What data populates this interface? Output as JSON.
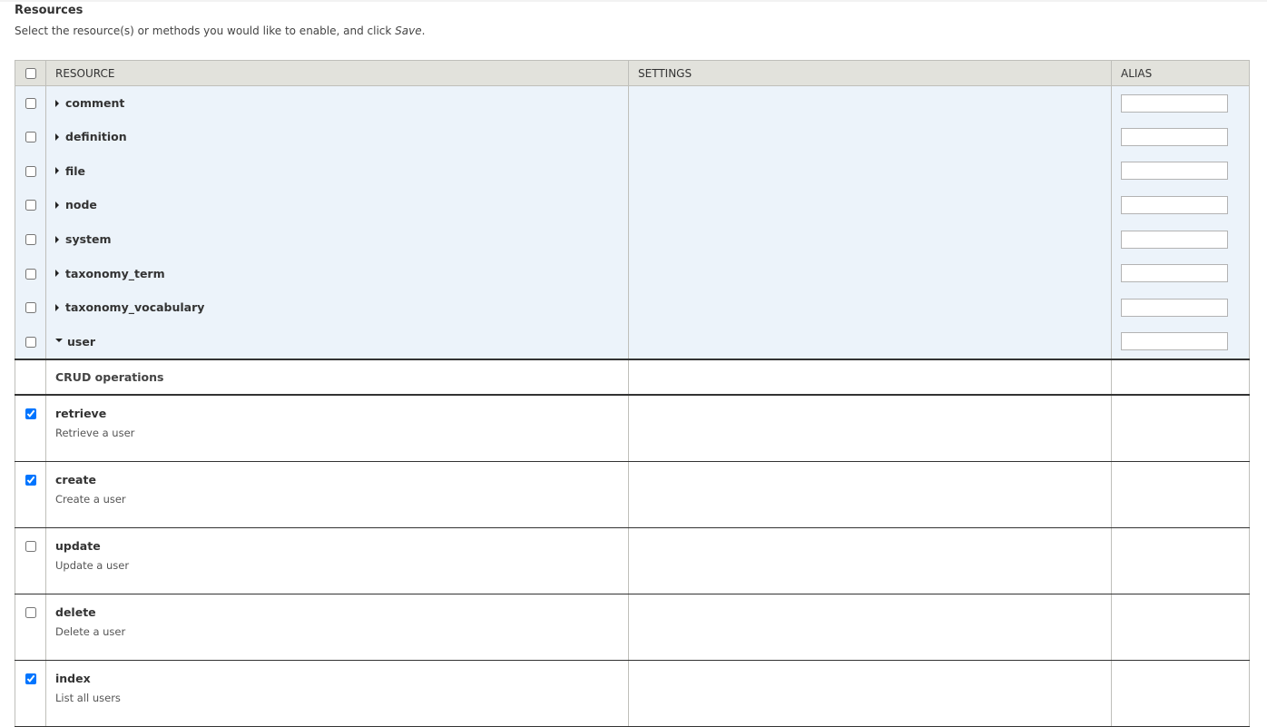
{
  "section": {
    "title": "Resources",
    "description_prefix": "Select the resource(s) or methods you would like to enable, and click ",
    "description_emph": "Save",
    "description_suffix": "."
  },
  "table": {
    "headers": {
      "resource": "RESOURCE",
      "settings": "SETTINGS",
      "alias": "ALIAS"
    },
    "resources": [
      {
        "name": "comment",
        "expanded": false,
        "checked": false,
        "alias": ""
      },
      {
        "name": "definition",
        "expanded": false,
        "checked": false,
        "alias": ""
      },
      {
        "name": "file",
        "expanded": false,
        "checked": false,
        "alias": ""
      },
      {
        "name": "node",
        "expanded": false,
        "checked": false,
        "alias": ""
      },
      {
        "name": "system",
        "expanded": false,
        "checked": false,
        "alias": ""
      },
      {
        "name": "taxonomy_term",
        "expanded": false,
        "checked": false,
        "alias": ""
      },
      {
        "name": "taxonomy_vocabulary",
        "expanded": false,
        "checked": false,
        "alias": ""
      },
      {
        "name": "user",
        "expanded": true,
        "checked": false,
        "alias": ""
      }
    ],
    "crud_label": "CRUD operations",
    "operations": [
      {
        "name": "retrieve",
        "description": "Retrieve a user",
        "checked": true
      },
      {
        "name": "create",
        "description": "Create a user",
        "checked": true
      },
      {
        "name": "update",
        "description": "Update a user",
        "checked": false
      },
      {
        "name": "delete",
        "description": "Delete a user",
        "checked": false
      },
      {
        "name": "index",
        "description": "List all users",
        "checked": true
      }
    ]
  },
  "icons": {
    "collapsed": "triangle-right-icon",
    "expanded": "triangle-down-icon"
  },
  "colors": {
    "header_bg": "#e2e2dc",
    "group_bg": "#ecf3fa",
    "separator": "#333333"
  }
}
